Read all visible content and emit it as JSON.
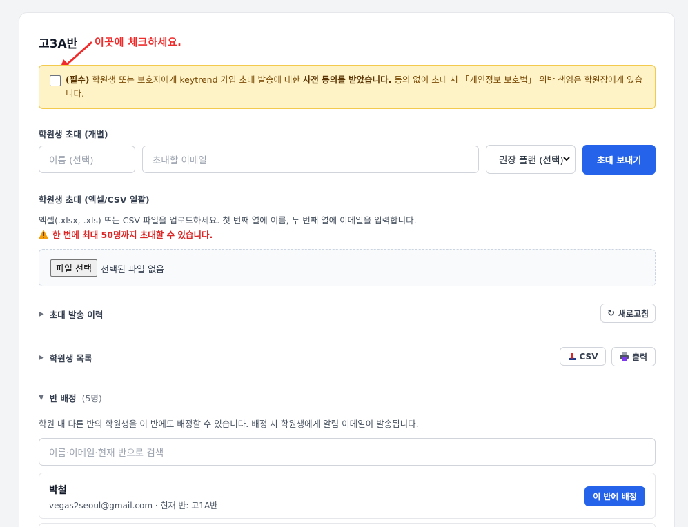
{
  "class_title": "고3A반",
  "annotation": "이곳에 체크하세요.",
  "consent": {
    "required": "(필수)",
    "text1": " 학원생 또는 보호자에게 keytrend 가입 초대 발송에 대한 ",
    "bold": "사전 동의를 받았습니다.",
    "text2": " 동의 없이 초대 시 「개인정보 보호법」 위반 책임은 학원장에게 있습니다."
  },
  "individual": {
    "label": "학원생 초대 (개별)",
    "name_placeholder": "이름 (선택)",
    "email_placeholder": "초대할 이메일",
    "plan_selected": "권장 플랜 (선택)",
    "send_label": "초대 보내기"
  },
  "bulk": {
    "label": "학원생 초대 (엑셀/CSV 일괄)",
    "description": "엑셀(.xlsx, .xls) 또는 CSV 파일을 업로드하세요. 첫 번째 열에 이름, 두 번째 열에 이메일을 입력합니다.",
    "warning": "한 번에 최대 50명까지 초대할 수 있습니다.",
    "file_button": "파일 선택",
    "file_status": "선택된 파일 없음"
  },
  "history": {
    "label": "초대 발송 이력",
    "refresh_label": "새로고침"
  },
  "students": {
    "label": "학원생 목록",
    "csv_label": "CSV",
    "print_label": "출력"
  },
  "assign": {
    "label": "반 배정",
    "count": "(5명)",
    "description": "학원 내 다른 반의 학원생을 이 반에도 배정할 수 있습니다. 배정 시 학원생에게 알림 이메일이 발송됩니다.",
    "search_placeholder": "이름·이메일·현재 반으로 검색",
    "items": [
      {
        "name": "박철",
        "email": "vegas2seoul@gmail.com",
        "current_class": " · 현재 반: 고1A반",
        "button": "이 반에 배정"
      }
    ]
  },
  "colors": {
    "primary": "#2563eb",
    "warning_bg": "#fef3c7",
    "annotation": "#ef2b2b"
  }
}
